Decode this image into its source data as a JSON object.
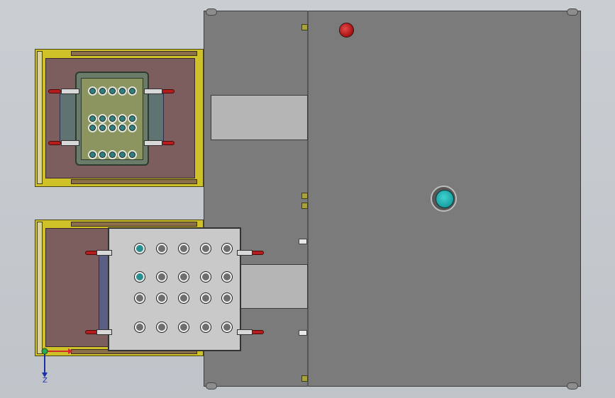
{
  "view": {
    "background": "#c6cbd0",
    "colors": {
      "machine_body": "#7b7b7b",
      "fixture_base": "#cfc229",
      "fixture_plate": "#7c5e5e",
      "clamp_handle": "#b51d1d",
      "emergency_stop": "#c41e1e",
      "start_button": "#2bb5b5"
    }
  },
  "axis_triad": {
    "z_label": "Z"
  },
  "upper_fixture": {
    "socket_rows": [
      5,
      5,
      5,
      5
    ]
  },
  "lower_fixture": {
    "hole_grid_rows": 4,
    "hole_grid_cols": 5
  }
}
